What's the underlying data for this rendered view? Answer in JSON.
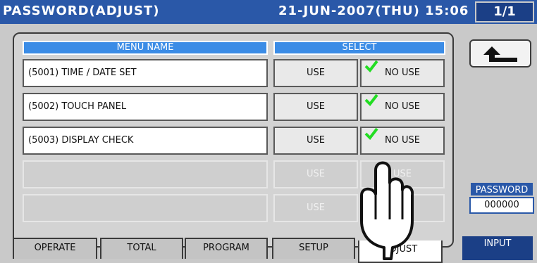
{
  "header": {
    "title": "PASSWORD(ADJUST)",
    "datetime": "21-JUN-2007(THU) 15:06",
    "page_indicator": "1/1"
  },
  "table": {
    "col_name_header": "MENU NAME",
    "col_select_header": "SELECT",
    "rows": [
      {
        "name": "(5001) TIME / DATE SET",
        "use_label": "USE",
        "nouse_label": "NO USE"
      },
      {
        "name": "(5002) TOUCH PANEL",
        "use_label": "USE",
        "nouse_label": "NO USE"
      },
      {
        "name": "(5003) DISPLAY CHECK",
        "use_label": "USE",
        "nouse_label": "NO USE"
      },
      {
        "name": "",
        "use_label": "USE",
        "nouse_label": "USE"
      },
      {
        "name": "",
        "use_label": "USE",
        "nouse_label": "USE"
      }
    ]
  },
  "tabs": [
    {
      "label": "OPERATE"
    },
    {
      "label": "TOTAL"
    },
    {
      "label": "PROGRAM"
    },
    {
      "label": "SETUP"
    },
    {
      "label": "ADJUST"
    }
  ],
  "right": {
    "password_label": "PASSWORD",
    "password_value": "000000",
    "input_label": "INPUT",
    "back_icon": "back-arrow-icon"
  },
  "colors": {
    "title_bg": "#2a58a8",
    "header_cell": "#3b8ce6",
    "check": "#22dd22"
  }
}
